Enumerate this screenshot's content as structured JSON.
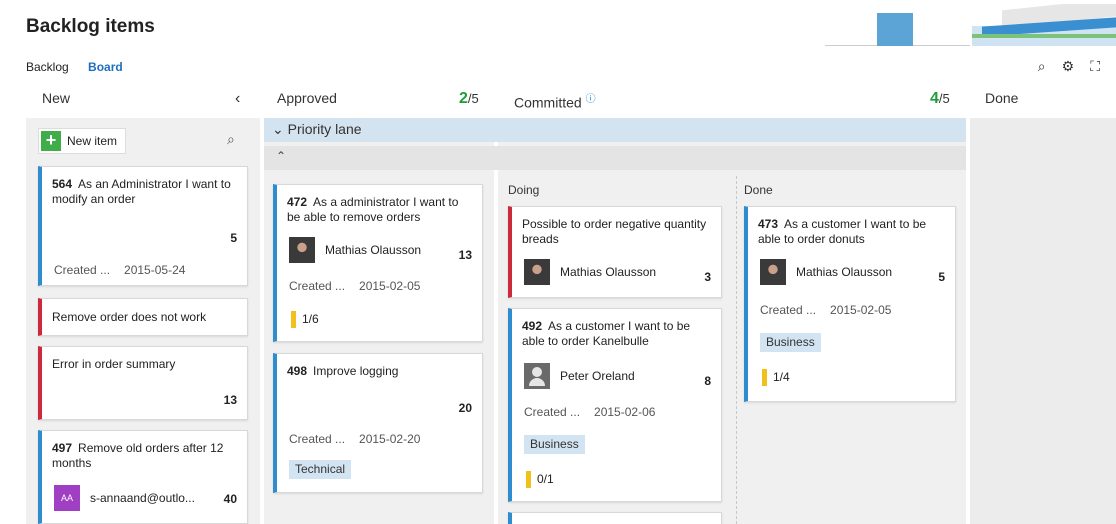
{
  "header": {
    "title": "Backlog items",
    "view_backlog": "Backlog",
    "view_board": "Board"
  },
  "colors": {
    "accent": "#1f6fbf",
    "story": "#2e8ccf",
    "bug": "#cc293d",
    "count_ok": "#1e9e3a",
    "tag_bg": "#d2e4f2"
  },
  "columns": {
    "new": {
      "label": "New",
      "collapse_glyph": "‹"
    },
    "approved": {
      "label": "Approved",
      "count": "2",
      "limit": "/5"
    },
    "committed": {
      "label": "Committed",
      "count": "4",
      "limit": "/5"
    },
    "done": {
      "label": "Done"
    }
  },
  "lanes": {
    "priority": "Priority lane"
  },
  "subcolumns": {
    "doing": "Doing",
    "done": "Done"
  },
  "new_item": {
    "label": "New item"
  },
  "cards": {
    "c564": {
      "id": "564",
      "title": "As an Administrator I want to modify an order",
      "effort": "5",
      "created_label": "Created ...",
      "created_date": "2015-05-24"
    },
    "cbug1": {
      "title": "Remove order does not work"
    },
    "cbug2": {
      "title": "Error in order summary",
      "effort": "13"
    },
    "c497": {
      "id": "497",
      "title": "Remove old orders after 12 months",
      "assignee_initials": "AA",
      "assignee": "s-annaand@outlo...",
      "effort": "40"
    },
    "c472": {
      "id": "472",
      "title": "As a administrator I want to be able to remove orders",
      "assignee": "Mathias Olausson",
      "effort": "13",
      "created_label": "Created ...",
      "created_date": "2015-02-05",
      "tasks": "1/6"
    },
    "c498": {
      "id": "498",
      "title": "Improve logging",
      "effort": "20",
      "created_label": "Created ...",
      "created_date": "2015-02-20",
      "tag": "Technical"
    },
    "cbug3": {
      "title": "Possible to order negative quantity breads",
      "assignee": "Mathias Olausson",
      "effort": "3"
    },
    "c492": {
      "id": "492",
      "title": "As a customer I want to be able to order Kanelbulle",
      "assignee": "Peter Oreland",
      "effort": "8",
      "created_label": "Created ...",
      "created_date": "2015-02-06",
      "tag": "Business",
      "tasks": "0/1"
    },
    "c473": {
      "id": "473",
      "title": "As a customer I want to be able to order donuts",
      "assignee": "Mathias Olausson",
      "effort": "5",
      "created_label": "Created ...",
      "created_date": "2015-02-05",
      "tag": "Business",
      "tasks": "1/4"
    }
  },
  "icons": {
    "search": "search-icon",
    "settings": "gear-icon",
    "fullscreen": "fullscreen-icon",
    "info": "info-icon"
  }
}
